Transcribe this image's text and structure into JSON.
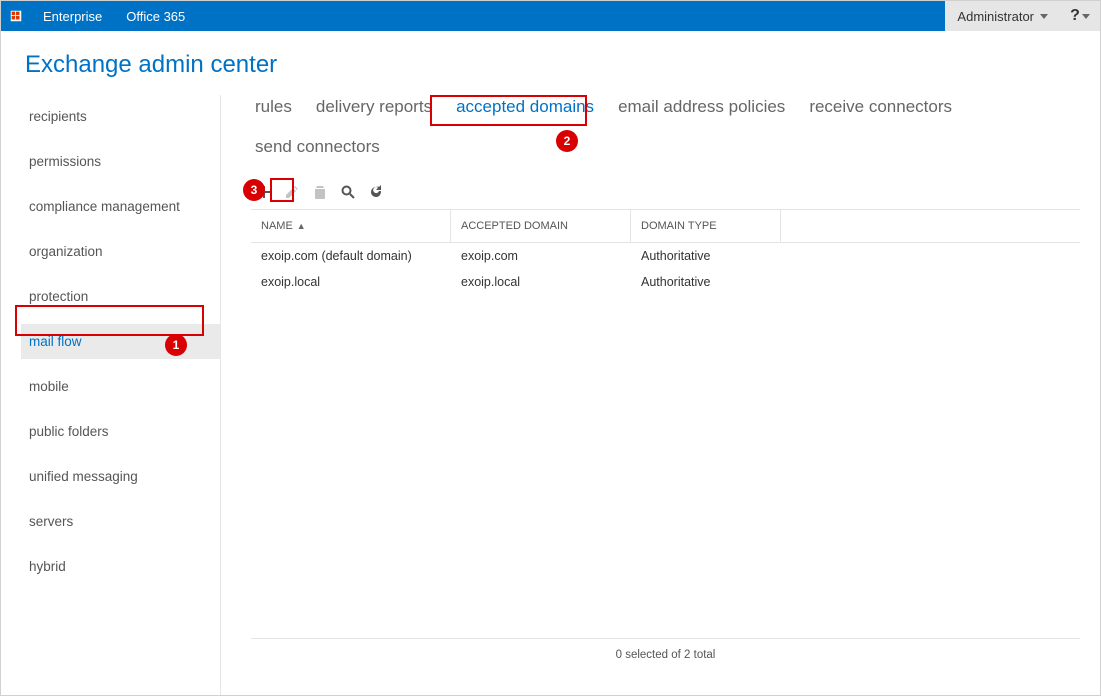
{
  "topbar": {
    "enterprise": "Enterprise",
    "office365": "Office 365",
    "user": "Administrator",
    "help": "?"
  },
  "page_title": "Exchange admin center",
  "sidebar": {
    "items": [
      {
        "label": "recipients"
      },
      {
        "label": "permissions"
      },
      {
        "label": "compliance management"
      },
      {
        "label": "organization"
      },
      {
        "label": "protection"
      },
      {
        "label": "mail flow"
      },
      {
        "label": "mobile"
      },
      {
        "label": "public folders"
      },
      {
        "label": "unified messaging"
      },
      {
        "label": "servers"
      },
      {
        "label": "hybrid"
      }
    ],
    "selected": "mail flow"
  },
  "tabs": {
    "items": [
      {
        "label": "rules"
      },
      {
        "label": "delivery reports"
      },
      {
        "label": "accepted domains"
      },
      {
        "label": "email address policies"
      },
      {
        "label": "receive connectors"
      },
      {
        "label": "send connectors"
      }
    ],
    "active": "accepted domains"
  },
  "toolbar": {
    "add": "add-icon",
    "edit": "edit-icon",
    "delete": "delete-icon",
    "search": "search-icon",
    "refresh": "refresh-icon"
  },
  "table": {
    "headers": {
      "name": "NAME",
      "domain": "ACCEPTED DOMAIN",
      "type": "DOMAIN TYPE"
    },
    "rows": [
      {
        "name": "exoip.com (default domain)",
        "domain": "exoip.com",
        "type": "Authoritative"
      },
      {
        "name": "exoip.local",
        "domain": "exoip.local",
        "type": "Authoritative"
      }
    ]
  },
  "status": "0 selected of 2 total",
  "annotations": {
    "one": "1",
    "two": "2",
    "three": "3"
  }
}
